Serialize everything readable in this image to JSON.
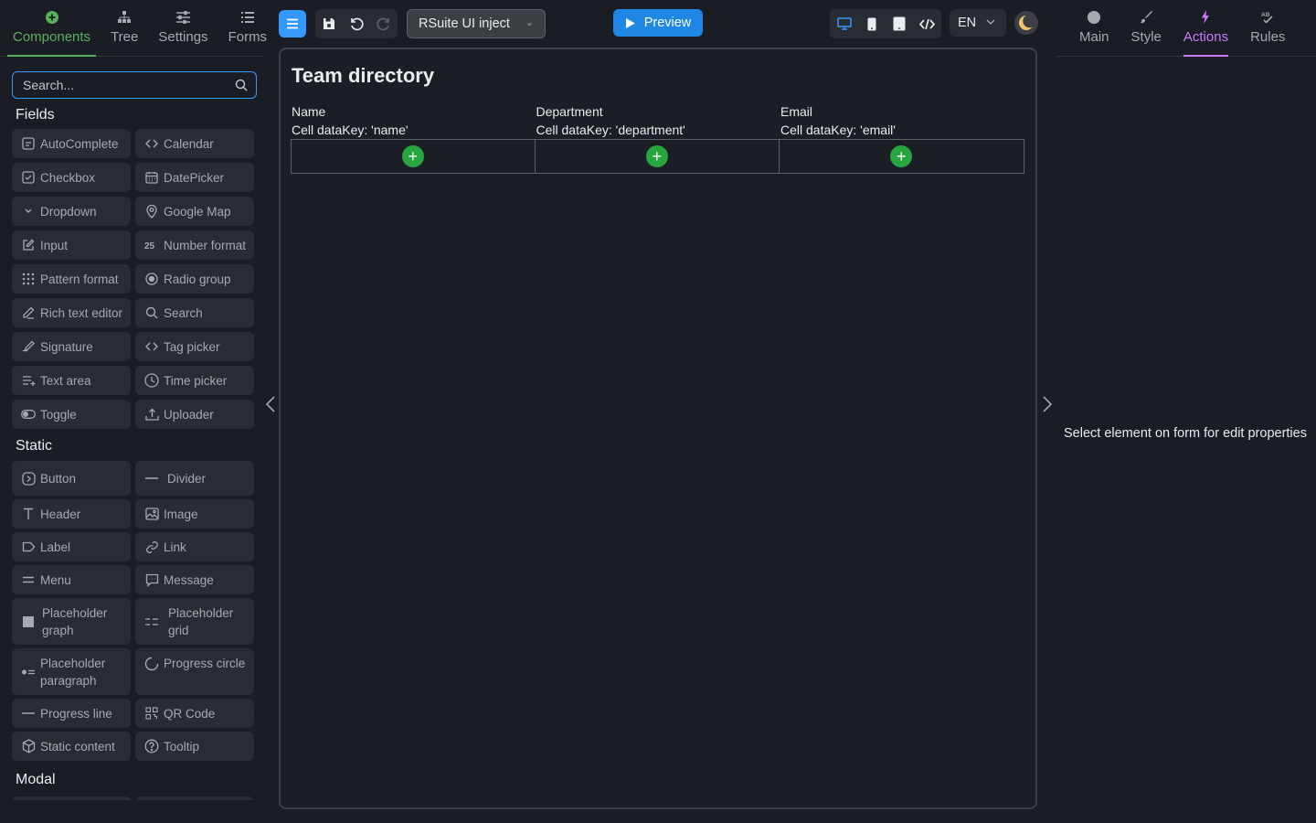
{
  "left_tabs": [
    {
      "label": "Components",
      "icon": "plus-circle-icon"
    },
    {
      "label": "Tree",
      "icon": "tree-icon"
    },
    {
      "label": "Settings",
      "icon": "sliders-icon"
    },
    {
      "label": "Forms",
      "icon": "list-icon"
    }
  ],
  "search": {
    "placeholder": "Search..."
  },
  "sections": {
    "fields": "Fields",
    "static": "Static",
    "modal": "Modal"
  },
  "fields": [
    "AutoComplete",
    "Calendar",
    "Checkbox",
    "DatePicker",
    "Dropdown",
    "Google Map",
    "Input",
    "Number format",
    "Pattern format",
    "Radio group",
    "Rich text editor",
    "Search",
    "Signature",
    "Tag picker",
    "Text area",
    "Time picker",
    "Toggle",
    "Uploader"
  ],
  "static_items": [
    "Button",
    "Divider",
    "Header",
    "Image",
    "Label",
    "Link",
    "Menu",
    "Message",
    "Placeholder graph",
    "Placeholder grid",
    "Placeholder paragraph",
    "Progress circle",
    "Progress line",
    "QR Code",
    "Static content",
    "Tooltip"
  ],
  "toolbar": {
    "form_select": "RSuite UI inject",
    "preview_label": "Preview",
    "language": "EN"
  },
  "form": {
    "title": "Team directory",
    "columns": [
      {
        "header": "Name",
        "cell": "Cell dataKey: 'name'"
      },
      {
        "header": "Department",
        "cell": "Cell dataKey: 'department'"
      },
      {
        "header": "Email",
        "cell": "Cell dataKey: 'email'"
      }
    ],
    "add_symbol": "+"
  },
  "right_tabs": [
    {
      "label": "Main",
      "icon": "circle-icon"
    },
    {
      "label": "Style",
      "icon": "brush-icon"
    },
    {
      "label": "Actions",
      "icon": "lightning-icon"
    },
    {
      "label": "Rules",
      "icon": "rules-icon"
    }
  ],
  "right_panel": {
    "hint": "Select element on form for edit properties"
  },
  "colors": {
    "background": "#1a1d24",
    "panel_item": "#292d33",
    "accent_blue": "#3498ff",
    "accent_green": "#58b15b",
    "accent_purple": "#cf77ff",
    "add_button": "#27a640"
  }
}
